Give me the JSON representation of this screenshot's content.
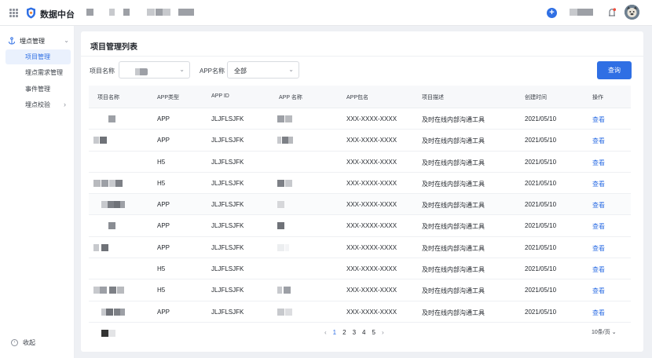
{
  "brand": {
    "title": "数据中台"
  },
  "sidebar": {
    "group_label": "埋点管理",
    "items": [
      {
        "label": "项目管理",
        "active": true
      },
      {
        "label": "埋点需求管理",
        "active": false
      },
      {
        "label": "事件管理",
        "active": false
      },
      {
        "label": "埋点校验",
        "active": false
      }
    ],
    "collapse_label": "收起"
  },
  "page": {
    "title": "项目管理列表"
  },
  "filters": {
    "project_name_label": "项目名称",
    "app_name_label": "APP名称",
    "app_name_value": "全部",
    "query_button": "查询"
  },
  "table": {
    "columns": [
      "项目名称",
      "APP类型",
      "APP ID",
      "APP 名称",
      "APP包名",
      "项目描述",
      "创建时间",
      "操作"
    ],
    "rows": [
      {
        "type": "APP",
        "app_id": "JLJFLSJFK",
        "pkg": "XXX-XXXX-XXXX",
        "desc": "及时在线内部沟通工具",
        "created": "2021/05/10",
        "action": "查看"
      },
      {
        "type": "APP",
        "app_id": "JLJFLSJFK",
        "pkg": "XXX-XXXX-XXXX",
        "desc": "及时在线内部沟通工具",
        "created": "2021/05/10",
        "action": "查看"
      },
      {
        "type": "H5",
        "app_id": "JLJFLSJFK",
        "pkg": "XXX-XXXX-XXXX",
        "desc": "及时在线内部沟通工具",
        "created": "2021/05/10",
        "action": "查看"
      },
      {
        "type": "H5",
        "app_id": "JLJFLSJFK",
        "pkg": "XXX-XXXX-XXXX",
        "desc": "及时在线内部沟通工具",
        "created": "2021/05/10",
        "action": "查看"
      },
      {
        "type": "APP",
        "app_id": "JLJFLSJFK",
        "pkg": "XXX-XXXX-XXXX",
        "desc": "及时在线内部沟通工具",
        "created": "2021/05/10",
        "action": "查看"
      },
      {
        "type": "APP",
        "app_id": "JLJFLSJFK",
        "pkg": "XXX-XXXX-XXXX",
        "desc": "及时在线内部沟通工具",
        "created": "2021/05/10",
        "action": "查看"
      },
      {
        "type": "APP",
        "app_id": "JLJFLSJFK",
        "pkg": "XXX-XXXX-XXXX",
        "desc": "及时在线内部沟通工具",
        "created": "2021/05/10",
        "action": "查看"
      },
      {
        "type": "H5",
        "app_id": "JLJFLSJFK",
        "pkg": "XXX-XXXX-XXXX",
        "desc": "及时在线内部沟通工具",
        "created": "2021/05/10",
        "action": "查看"
      },
      {
        "type": "H5",
        "app_id": "JLJFLSJFK",
        "pkg": "XXX-XXXX-XXXX",
        "desc": "及时在线内部沟通工具",
        "created": "2021/05/10",
        "action": "查看"
      },
      {
        "type": "APP",
        "app_id": "JLJFLSJFK",
        "pkg": "XXX-XXXX-XXXX",
        "desc": "及时在线内部沟通工具",
        "created": "2021/05/10",
        "action": "查看"
      }
    ]
  },
  "pagination": {
    "prev": "‹",
    "pages": [
      "1",
      "2",
      "3",
      "4",
      "5"
    ],
    "current": "1",
    "next": "›",
    "page_size": "10条/页"
  },
  "colors": {
    "primary": "#2f6fe4",
    "active_bg": "#eaf1fd"
  },
  "icons": {
    "apps": "grid-icon",
    "logo": "shield-logo-icon",
    "add": "plus-icon",
    "notify": "bell-icon",
    "menu": "anchor-icon",
    "collapse": "collapse-icon"
  }
}
